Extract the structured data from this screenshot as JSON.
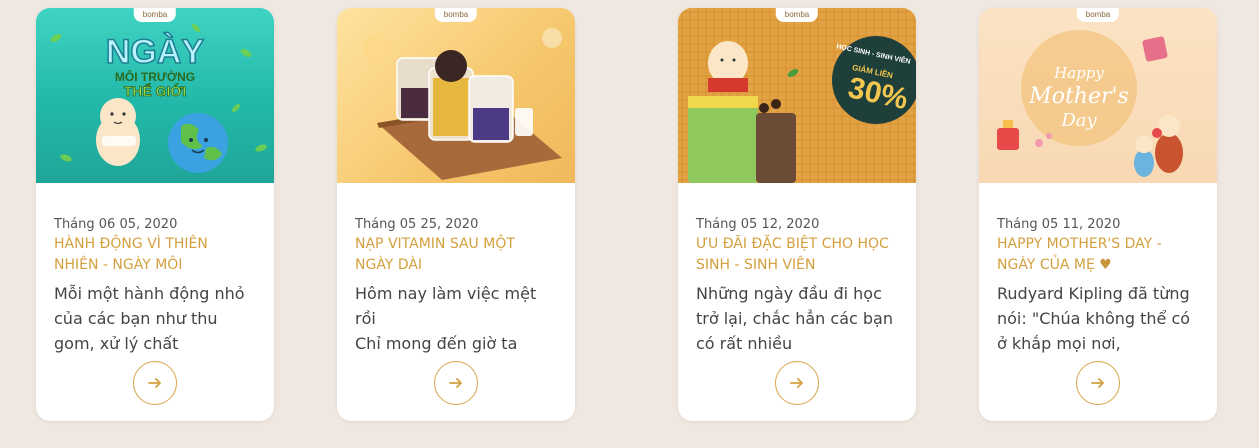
{
  "brand": "bomba",
  "colors": {
    "background": "#efe8e0",
    "accent": "#d4a03f",
    "card": "#ffffff"
  },
  "cards": [
    {
      "image_text": {
        "line1": "NGÀY",
        "line2": "MÔI TRƯỜNG",
        "line3": "THẾ GIỚI"
      },
      "date": "Tháng 06 05, 2020",
      "title": "HÀNH ĐỘNG VÌ THIÊN NHIÊN - NGÀY MÔI",
      "excerpt": "Mỗi một hành động nhỏ của các bạn như thu gom, xử lý chất",
      "arrow_icon": "arrow-right-icon"
    },
    {
      "date": "Tháng 05 25, 2020",
      "title": "NẠP VITAMIN SAU MỘT NGÀY DÀI",
      "excerpt": "Hôm nay làm việc mệt rồi\nChỉ mong đến giờ ta",
      "arrow_icon": "arrow-right-icon"
    },
    {
      "image_text": {
        "badge_top": "HỌC SINH - SINH VIÊN",
        "badge_mid": "GIẢM LIỀN",
        "badge_big": "30%"
      },
      "date": "Tháng 05 12, 2020",
      "title": "ƯU ĐÃI ĐẶC BIỆT CHO HỌC SINH - SINH VIÊN",
      "excerpt": "Những ngày đầu đi học trở lại, chắc hẳn các bạn có rất nhiều",
      "arrow_icon": "arrow-right-icon"
    },
    {
      "image_text": {
        "line1": "Happy",
        "line2": "Mother's",
        "line3": "Day"
      },
      "date": "Tháng 05 11, 2020",
      "title": "HAPPY MOTHER'S DAY - NGÀY CỦA MẸ",
      "title_icon": "heart-icon",
      "excerpt": "Rudyard Kipling đã từng nói: \"Chúa không thể có ở khắp mọi nơi,",
      "arrow_icon": "arrow-right-icon"
    }
  ]
}
